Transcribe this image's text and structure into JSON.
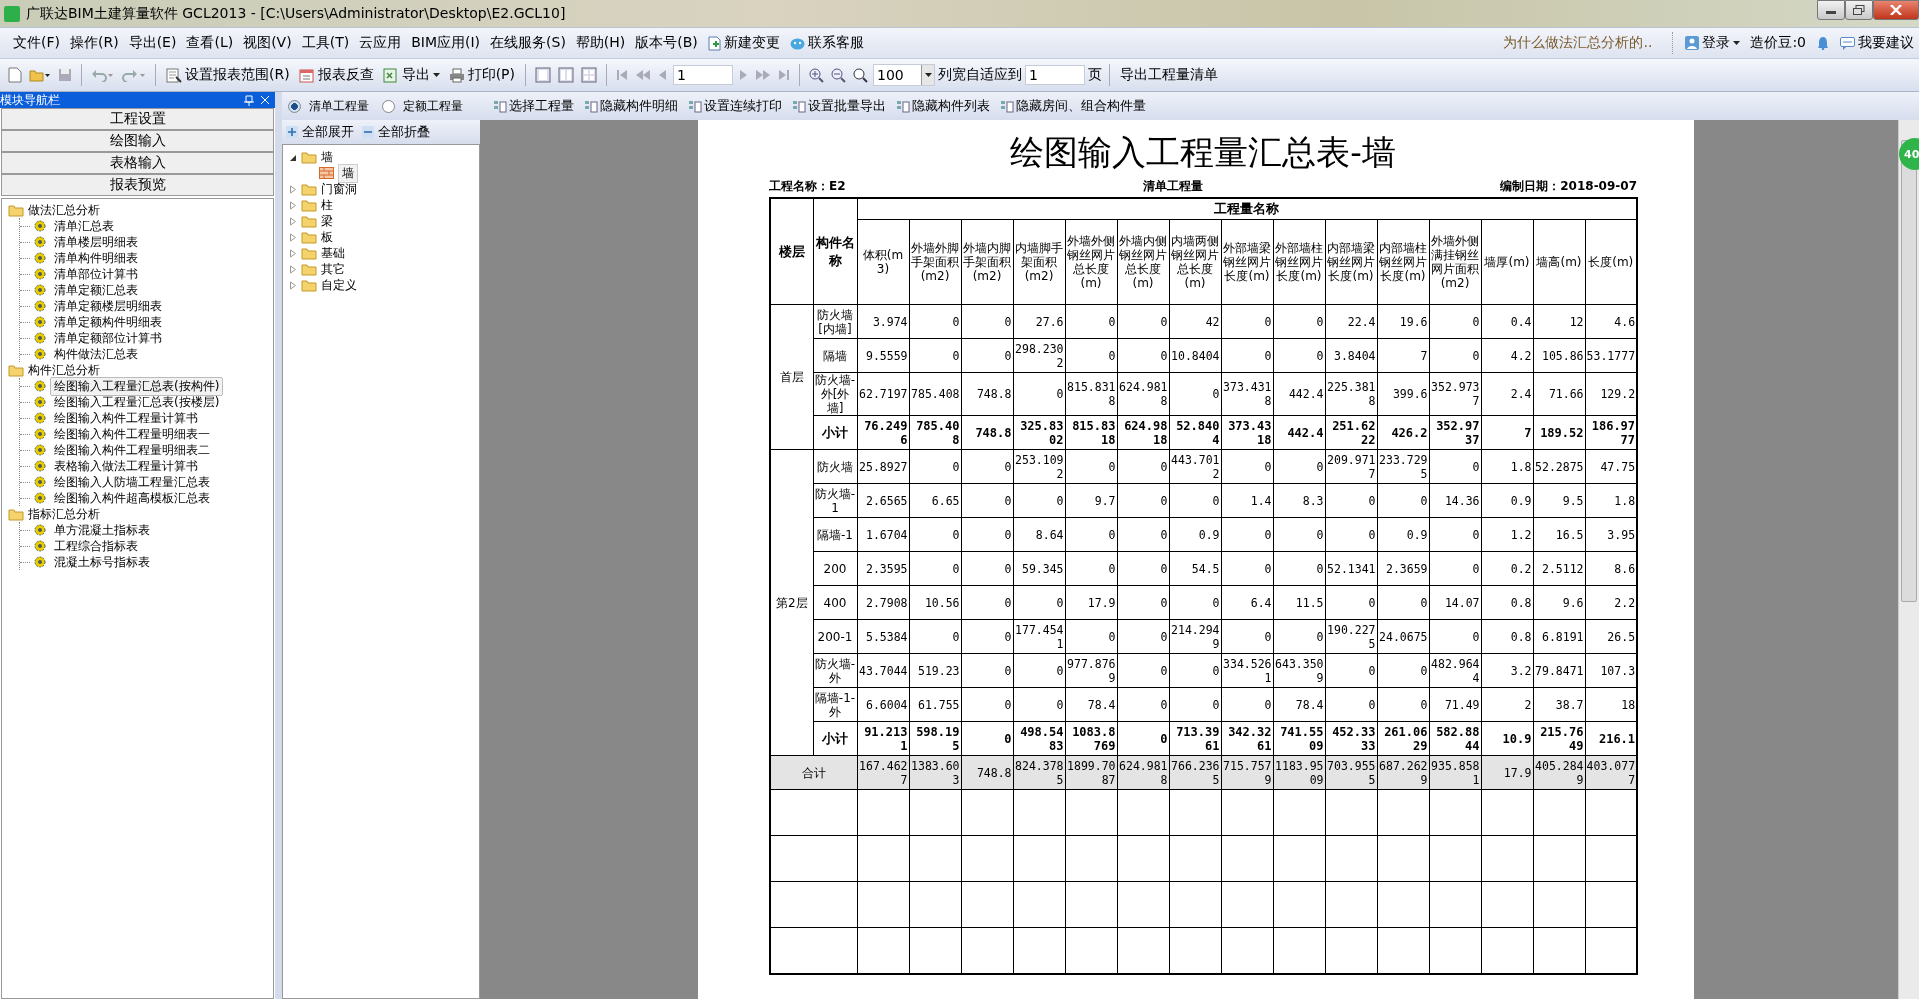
{
  "window": {
    "title": "广联达BIM土建算量软件 GCL2013 - [C:\\Users\\Administrator\\Desktop\\E2.GCL10]"
  },
  "menu_bar": {
    "items": [
      "文件(F)",
      "操作(R)",
      "导出(E)",
      "查看(L)",
      "视图(V)",
      "工具(T)",
      "云应用",
      "BIM应用(I)",
      "在线服务(S)",
      "帮助(H)",
      "版本号(B)"
    ],
    "new_change": "新建变更",
    "support": "联系客服",
    "notice": "为什么做法汇总分析的..",
    "login": "登录",
    "balance": "造价豆:0",
    "suggest": "我要建议"
  },
  "toolbar": {
    "report_range": "设置报表范围(R)",
    "reverse_lookup": "报表反查",
    "export": "导出",
    "print": "打印(P)",
    "page": "1",
    "zoom": "100",
    "fit_label": "列宽自适应到",
    "fit_value": "1",
    "fit_unit": "页",
    "export_list": "导出工程量清单"
  },
  "nav_panel": {
    "title": "模块导航栏",
    "sections": [
      "工程设置",
      "绘图输入",
      "表格输入",
      "报表预览"
    ],
    "tree": [
      {
        "label": "做法汇总分析",
        "children": [
          {
            "label": "清单汇总表",
            "selected": false
          },
          {
            "label": "清单楼层明细表",
            "selected": false
          },
          {
            "label": "清单构件明细表",
            "selected": false
          },
          {
            "label": "清单部位计算书",
            "selected": false
          },
          {
            "label": "清单定额汇总表",
            "selected": false
          },
          {
            "label": "清单定额楼层明细表",
            "selected": false
          },
          {
            "label": "清单定额构件明细表",
            "selected": false
          },
          {
            "label": "清单定额部位计算书",
            "selected": false
          },
          {
            "label": "构件做法汇总表",
            "selected": false
          }
        ]
      },
      {
        "label": "构件汇总分析",
        "children": [
          {
            "label": "绘图输入工程量汇总表(按构件)",
            "selected": true
          },
          {
            "label": "绘图输入工程量汇总表(按楼层)",
            "selected": false
          },
          {
            "label": "绘图输入构件工程量计算书",
            "selected": false
          },
          {
            "label": "绘图输入构件工程量明细表一",
            "selected": false
          },
          {
            "label": "绘图输入构件工程量明细表二",
            "selected": false
          },
          {
            "label": "表格输入做法工程量计算书",
            "selected": false
          },
          {
            "label": "绘图输入人防墙工程量汇总表",
            "selected": false
          },
          {
            "label": "绘图输入构件超高模板汇总表",
            "selected": false
          }
        ]
      },
      {
        "label": "指标汇总分析",
        "children": [
          {
            "label": "单方混凝土指标表",
            "selected": false
          },
          {
            "label": "工程综合指标表",
            "selected": false
          },
          {
            "label": "混凝土标号指标表",
            "selected": false
          }
        ]
      }
    ]
  },
  "report_options": {
    "modes": [
      {
        "label": "清单工程量",
        "selected": true
      },
      {
        "label": "定额工程量",
        "selected": false
      }
    ],
    "actions": [
      "选择工程量",
      "隐藏构件明细",
      "设置连续打印",
      "设置批量导出",
      "隐藏构件列表",
      "隐藏房间、组合构件量"
    ]
  },
  "component_tree": {
    "expand_all": "全部展开",
    "collapse_all": "全部折叠",
    "items": [
      {
        "label": "墙",
        "expanded": true,
        "children": [
          {
            "label": "墙",
            "selected": true
          }
        ]
      },
      {
        "label": "门窗洞",
        "expanded": false
      },
      {
        "label": "柱",
        "expanded": false
      },
      {
        "label": "梁",
        "expanded": false
      },
      {
        "label": "板",
        "expanded": false
      },
      {
        "label": "基础",
        "expanded": false
      },
      {
        "label": "其它",
        "expanded": false
      },
      {
        "label": "自定义",
        "expanded": false
      }
    ]
  },
  "report": {
    "title": "绘图输入工程量汇总表-墙",
    "project": "工程名称：E2",
    "type": "清单工程量",
    "date": "编制日期：2018-09-07",
    "group_header": "工程量名称",
    "columns": [
      "楼层",
      "构件名称",
      "体积(m3)",
      "外墙外脚手架面积(m2)",
      "外墙内脚手架面积(m2)",
      "内墙脚手架面积(m2)",
      "外墙外侧钢丝网片总长度(m)",
      "外墙内侧钢丝网片总长度(m)",
      "内墙两侧钢丝网片总长度(m)",
      "外部墙梁钢丝网片长度(m)",
      "外部墙柱钢丝网片长度(m)",
      "内部墙梁钢丝网片长度(m)",
      "内部墙柱钢丝网片长度(m)",
      "外墙外侧满挂钢丝网片面积(m2)",
      "墙厚(m)",
      "墙高(m)",
      "长度(m)"
    ],
    "groups": [
      {
        "floor": "首层",
        "rows": [
          {
            "name": "防火墙[内墙]",
            "values": [
              "3.974",
              "0",
              "0",
              "27.6",
              "0",
              "0",
              "42",
              "0",
              "0",
              "22.4",
              "19.6",
              "0",
              "0.4",
              "12",
              "4.6"
            ]
          },
          {
            "name": "隔墙",
            "values": [
              "9.5559",
              "0",
              "0",
              "298.2302",
              "0",
              "0",
              "10.8404",
              "0",
              "0",
              "3.8404",
              "7",
              "0",
              "4.2",
              "105.86",
              "53.1777"
            ]
          },
          {
            "name": "防火墙-外[外墙]",
            "values": [
              "62.7197",
              "785.408",
              "748.8",
              "0",
              "815.8318",
              "624.9818",
              "0",
              "373.4318",
              "442.4",
              "225.3818",
              "399.6",
              "352.9737",
              "2.4",
              "71.66",
              "129.2"
            ]
          }
        ],
        "subtotal": {
          "label": "小计",
          "values": [
            "76.2496",
            "785.408",
            "748.8",
            "325.8302",
            "815.8318",
            "624.9818",
            "52.8404",
            "373.4318",
            "442.4",
            "251.6222",
            "426.2",
            "352.9737",
            "7",
            "189.52",
            "186.9777"
          ]
        }
      },
      {
        "floor": "第2层",
        "rows": [
          {
            "name": "防火墙",
            "values": [
              "25.8927",
              "0",
              "0",
              "253.1092",
              "0",
              "0",
              "443.7012",
              "0",
              "0",
              "209.9717",
              "233.7295",
              "0",
              "1.8",
              "52.2875",
              "47.75"
            ]
          },
          {
            "name": "防火墙-1",
            "values": [
              "2.6565",
              "6.65",
              "0",
              "0",
              "9.7",
              "0",
              "0",
              "1.4",
              "8.3",
              "0",
              "0",
              "14.36",
              "0.9",
              "9.5",
              "1.8"
            ]
          },
          {
            "name": "隔墙-1",
            "values": [
              "1.6704",
              "0",
              "0",
              "8.64",
              "0",
              "0",
              "0.9",
              "0",
              "0",
              "0",
              "0.9",
              "0",
              "1.2",
              "16.5",
              "3.95"
            ]
          },
          {
            "name": "200",
            "values": [
              "2.3595",
              "0",
              "0",
              "59.345",
              "0",
              "0",
              "54.5",
              "0",
              "0",
              "52.1341",
              "2.3659",
              "0",
              "0.2",
              "2.5112",
              "8.6"
            ]
          },
          {
            "name": "400",
            "values": [
              "2.7908",
              "10.56",
              "0",
              "0",
              "17.9",
              "0",
              "0",
              "6.4",
              "11.5",
              "0",
              "0",
              "14.07",
              "0.8",
              "9.6",
              "2.2"
            ]
          },
          {
            "name": "200-1",
            "values": [
              "5.5384",
              "0",
              "0",
              "177.4541",
              "0",
              "0",
              "214.2949",
              "0",
              "0",
              "190.2275",
              "24.0675",
              "0",
              "0.8",
              "6.8191",
              "26.5"
            ]
          },
          {
            "name": "防火墙-外",
            "values": [
              "43.7044",
              "519.23",
              "0",
              "0",
              "977.8769",
              "0",
              "0",
              "334.5261",
              "643.3509",
              "0",
              "0",
              "482.9644",
              "3.2",
              "79.8471",
              "107.3"
            ]
          },
          {
            "name": "隔墙-1-外",
            "values": [
              "6.6004",
              "61.755",
              "0",
              "0",
              "78.4",
              "0",
              "0",
              "0",
              "78.4",
              "0",
              "0",
              "71.49",
              "2",
              "38.7",
              "18"
            ]
          }
        ],
        "subtotal": {
          "label": "小计",
          "values": [
            "91.2131",
            "598.195",
            "0",
            "498.5483",
            "1083.8769",
            "0",
            "713.3961",
            "342.3261",
            "741.5509",
            "452.3333",
            "261.0629",
            "582.8844",
            "10.9",
            "215.7649",
            "216.1"
          ]
        }
      }
    ],
    "total": {
      "label": "合计",
      "values": [
        "167.4627",
        "1383.603",
        "748.8",
        "824.3785",
        "1899.7087",
        "624.9818",
        "766.2365",
        "715.7579",
        "1183.9509",
        "703.9555",
        "687.2629",
        "935.8581",
        "17.9",
        "405.2849",
        "403.0777"
      ]
    }
  },
  "side_badge": "40"
}
